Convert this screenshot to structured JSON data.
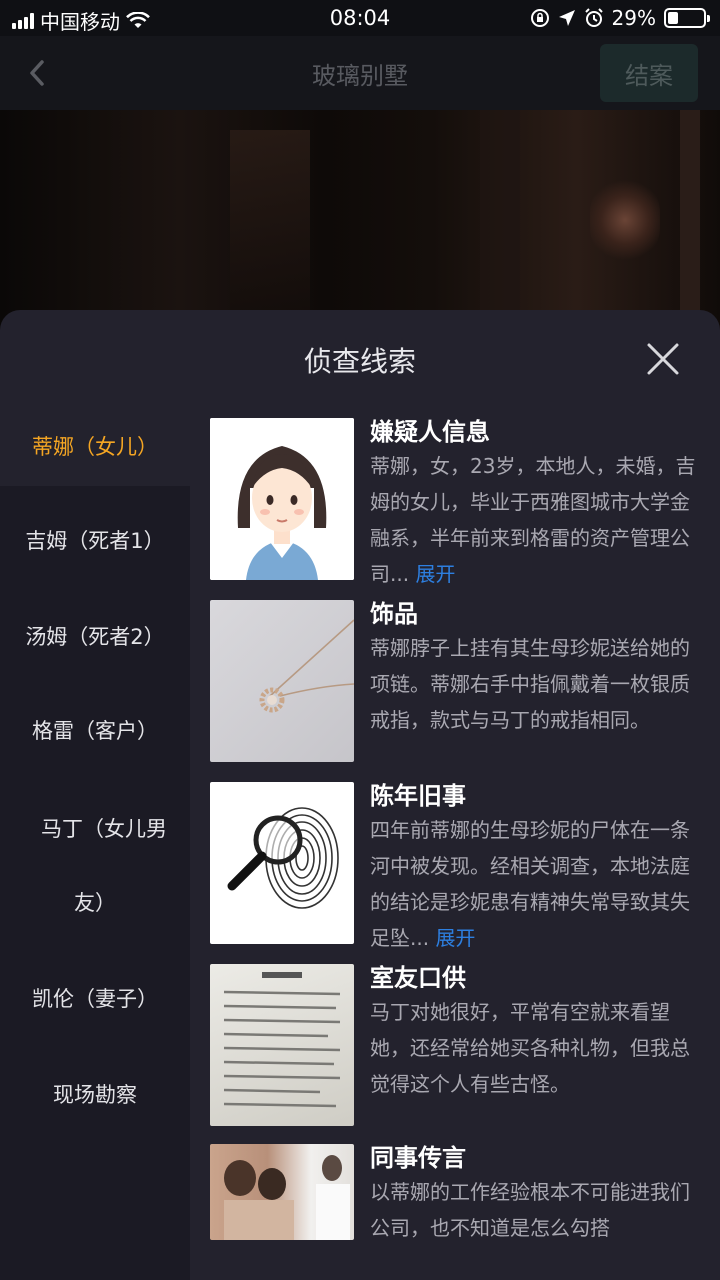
{
  "status_bar": {
    "carrier": "中国移动",
    "time": "08:04",
    "battery": "29%",
    "battery_level": 0.29
  },
  "nav": {
    "title": "玻璃别墅",
    "action_label": "结案"
  },
  "sheet": {
    "title": "侦查线索",
    "tabs": [
      {
        "label": "蒂娜（女儿）",
        "active": true
      },
      {
        "label": "吉姆（死者1）"
      },
      {
        "label": "汤姆（死者2）"
      },
      {
        "label": "格雷（客户）"
      },
      {
        "label_line1": "马丁（女儿男",
        "label_line2": "友）"
      },
      {
        "label": "凯伦（妻子）"
      },
      {
        "label": "现场勘察"
      }
    ],
    "clues": [
      {
        "title": "嫌疑人信息",
        "text": "蒂娜，女，23岁，本地人，未婚，吉姆的女儿，毕业于西雅图城市大学金融系，半年前来到格雷的资产管理公司...",
        "expand": "展开"
      },
      {
        "title": "饰品",
        "text": "蒂娜脖子上挂有其生母珍妮送给她的项链。蒂娜右手中指佩戴着一枚银质戒指，款式与马丁的戒指相同。"
      },
      {
        "title": "陈年旧事",
        "text": "四年前蒂娜的生母珍妮的尸体在一条河中被发现。经相关调查，本地法庭的结论是珍妮患有精神失常导致其失足坠...",
        "expand": "展开"
      },
      {
        "title": "室友口供",
        "text": "马丁对她很好，平常有空就来看望她，还经常给她买各种礼物，但我总觉得这个人有些古怪。"
      },
      {
        "title": "同事传言",
        "text": "以蒂娜的工作经验根本不可能进我们公司，也不知道是怎么勾搭"
      }
    ]
  }
}
